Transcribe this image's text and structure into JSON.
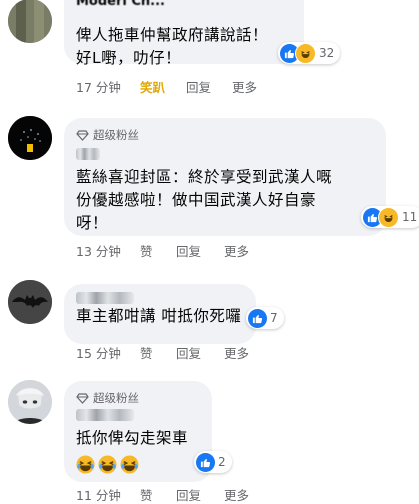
{
  "comments": [
    {
      "author": "Moderi Ch...",
      "text": "俾人拖車仲幫政府講說話！\n好L嘢，叻仔！",
      "reaction_count": "32",
      "time": "17 分钟",
      "like_label": "笑趴",
      "reply_label": "回复",
      "more_label": "更多"
    },
    {
      "badge": "超级粉丝",
      "text": "藍絲喜迎封區：終於享受到武漢人嘅\n份優越感啦！做中国武漢人好自豪\n呀！",
      "reaction_count": "11",
      "time": "13 分钟",
      "like_label": "赞",
      "reply_label": "回复",
      "more_label": "更多"
    },
    {
      "text": "車主都咁講 咁抵你死囉",
      "reaction_count": "7",
      "time": "15 分钟",
      "like_label": "赞",
      "reply_label": "回复",
      "more_label": "更多"
    },
    {
      "badge": "超级粉丝",
      "text": "抵你俾勾走架車",
      "reaction_count": "2",
      "time": "11 分钟",
      "like_label": "赞",
      "reply_label": "回复",
      "more_label": "更多"
    }
  ],
  "colors": {
    "bubble": "#f0f2f5",
    "meta_text": "#65676b",
    "haha_active": "#e0a800",
    "like_blue": "#1877f2",
    "haha_yellow": "#f7b928"
  },
  "icons": [
    "like-icon",
    "haha-icon",
    "diamond-icon",
    "laughing-emoji"
  ]
}
